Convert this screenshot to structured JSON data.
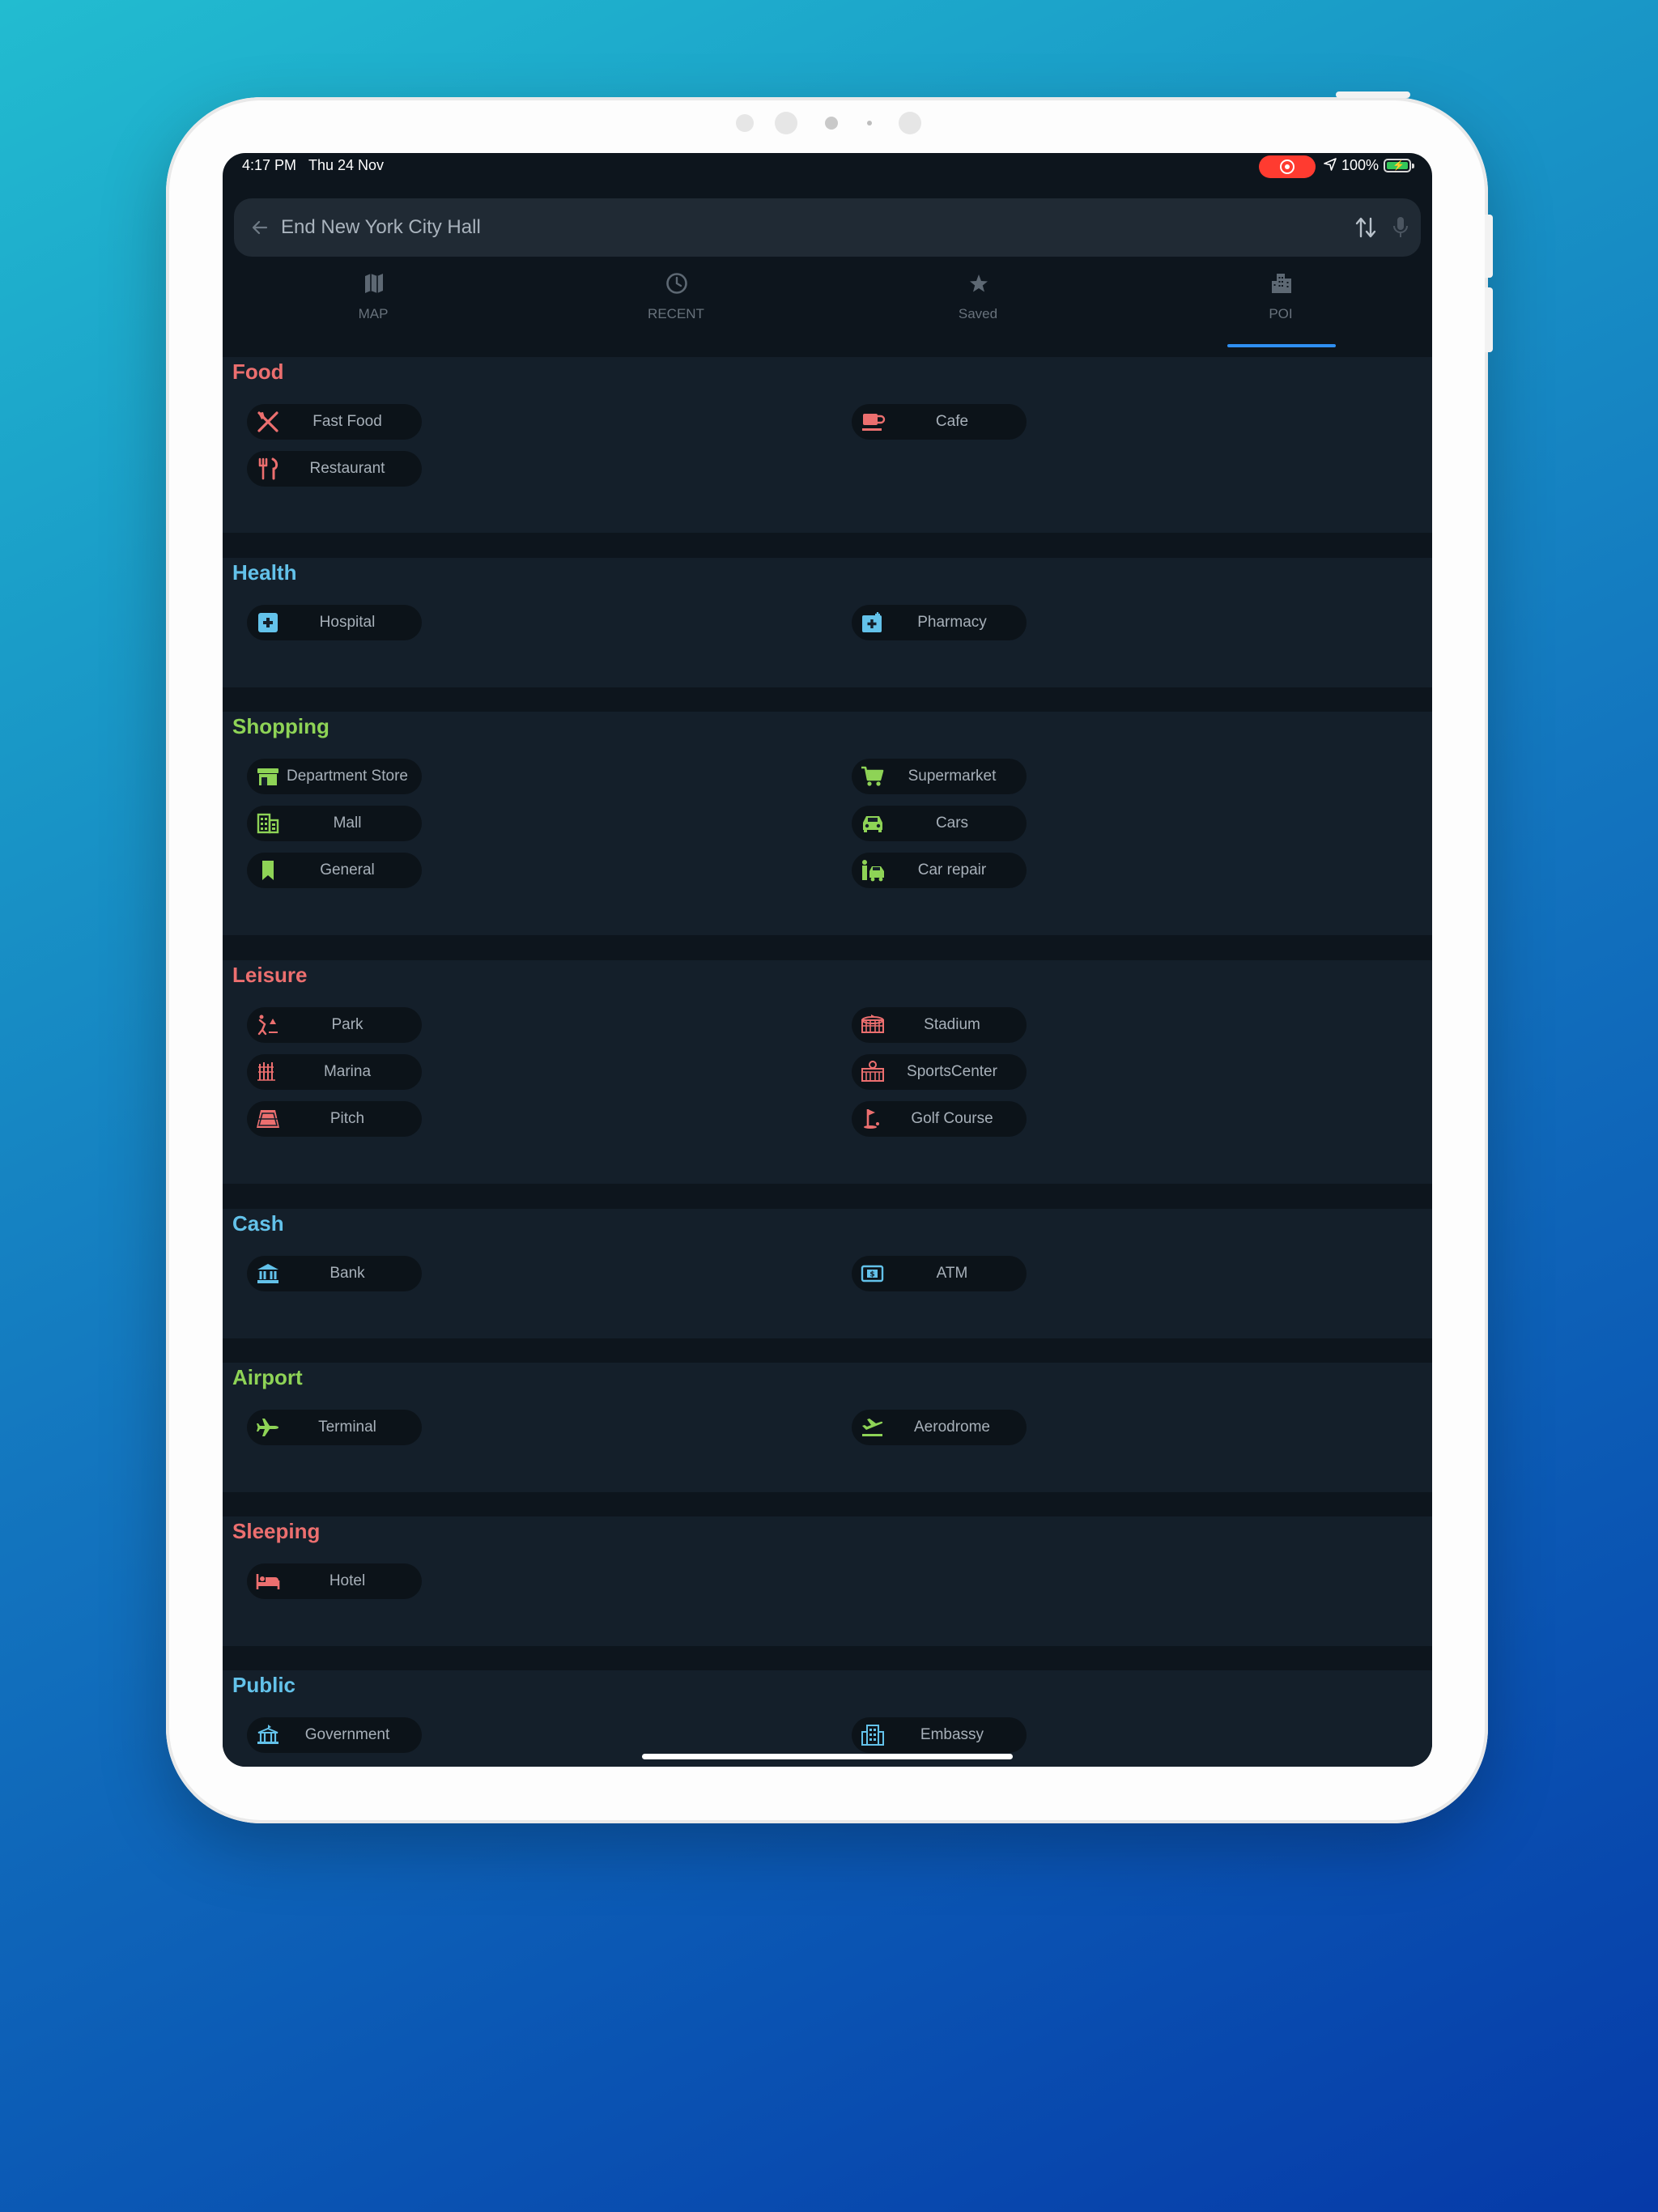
{
  "status_bar": {
    "time": "4:17 PM",
    "date": "Thu 24 Nov",
    "battery": "100%"
  },
  "search": {
    "value": "End New York City Hall"
  },
  "tabs": [
    {
      "label": "MAP",
      "icon": "map-icon",
      "active": false
    },
    {
      "label": "RECENT",
      "icon": "clock-icon",
      "active": false
    },
    {
      "label": "Saved",
      "icon": "star-icon",
      "active": false
    },
    {
      "label": "POI",
      "icon": "buildings-icon",
      "active": true
    }
  ],
  "colors": {
    "accent": "#2f8ff2",
    "food": "#ec6f6f",
    "health": "#63c2ea",
    "shopping": "#8ed356",
    "leisure": "#ec6f6f",
    "cash": "#63c2ea",
    "airport": "#8ed356",
    "sleeping": "#ec6f6f",
    "public": "#63c2ea"
  },
  "sections": [
    {
      "title": "Food",
      "items": [
        {
          "label": "Fast Food",
          "icon": "fork-knife-icon"
        },
        {
          "label": "Cafe",
          "icon": "coffee-cup-icon"
        },
        {
          "label": "Restaurant",
          "icon": "utensils-icon"
        }
      ]
    },
    {
      "title": "Health",
      "items": [
        {
          "label": "Hospital",
          "icon": "medical-cross-icon"
        },
        {
          "label": "Pharmacy",
          "icon": "pharmacy-icon"
        }
      ]
    },
    {
      "title": "Shopping",
      "items": [
        {
          "label": "Department Store",
          "icon": "storefront-icon"
        },
        {
          "label": "Supermarket",
          "icon": "shopping-cart-icon"
        },
        {
          "label": "Mall",
          "icon": "building-icon"
        },
        {
          "label": "Cars",
          "icon": "car-icon"
        },
        {
          "label": "General",
          "icon": "bookmark-icon"
        },
        {
          "label": "Car repair",
          "icon": "car-repair-icon"
        }
      ]
    },
    {
      "title": "Leisure",
      "items": [
        {
          "label": "Park",
          "icon": "park-icon"
        },
        {
          "label": "Stadium",
          "icon": "stadium-icon"
        },
        {
          "label": "Marina",
          "icon": "marina-icon"
        },
        {
          "label": "SportsCenter",
          "icon": "sports-center-icon"
        },
        {
          "label": "Pitch",
          "icon": "pitch-icon"
        },
        {
          "label": "Golf Course",
          "icon": "golf-flag-icon"
        }
      ]
    },
    {
      "title": "Cash",
      "items": [
        {
          "label": "Bank",
          "icon": "bank-icon"
        },
        {
          "label": "ATM",
          "icon": "atm-icon"
        }
      ]
    },
    {
      "title": "Airport",
      "items": [
        {
          "label": "Terminal",
          "icon": "airplane-icon"
        },
        {
          "label": "Aerodrome",
          "icon": "airplane-takeoff-icon"
        }
      ]
    },
    {
      "title": "Sleeping",
      "items": [
        {
          "label": "Hotel",
          "icon": "bed-icon"
        }
      ]
    },
    {
      "title": "Public",
      "items": [
        {
          "label": "Government",
          "icon": "government-building-icon"
        },
        {
          "label": "Embassy",
          "icon": "embassy-icon"
        }
      ]
    }
  ]
}
